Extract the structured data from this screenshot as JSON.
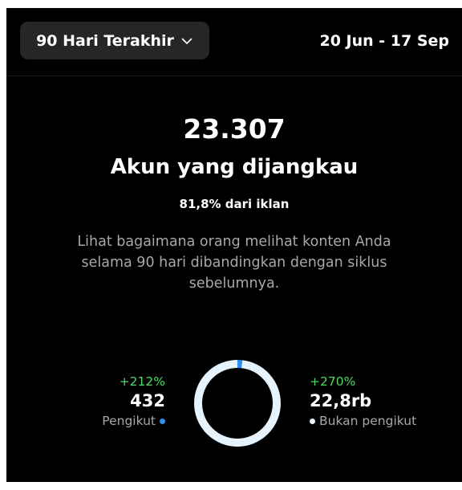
{
  "header": {
    "range_label": "90 Hari Terakhir",
    "date_range": "20 Jun - 17 Sep"
  },
  "summary": {
    "total": "23.307",
    "title": "Akun yang dijangkau",
    "ad_share": "81,8% dari iklan",
    "description": "Lihat bagaimana orang melihat konten Anda selama 90 hari dibandingkan dengan siklus sebelumnya."
  },
  "breakdown": {
    "followers": {
      "change": "+212%",
      "value": "432",
      "label": "Pengikut",
      "share": 0.0185
    },
    "non_followers": {
      "change": "+270%",
      "value": "22,8rb",
      "label": "Bukan pengikut",
      "share": 0.9815
    }
  },
  "colors": {
    "background": "#000000",
    "follower": "#2e8ff0",
    "non_follower": "#e6f2fc",
    "positive": "#4cd964",
    "muted_text": "#a8a8a8",
    "button_bg": "#262626"
  },
  "icons": {
    "range_dropdown": "chevron-down-icon"
  }
}
